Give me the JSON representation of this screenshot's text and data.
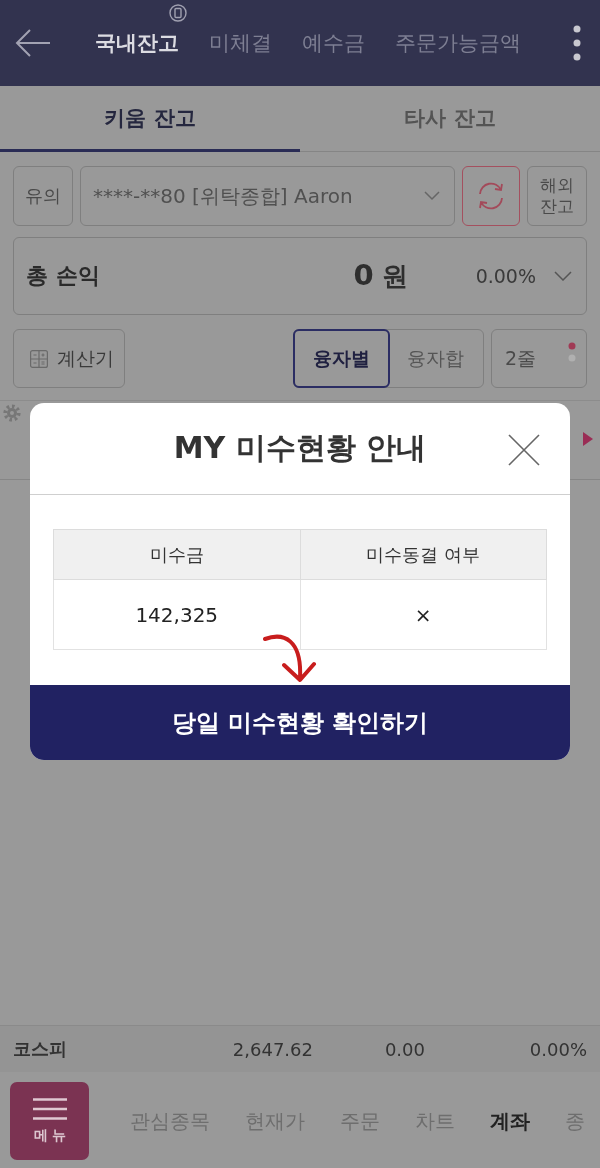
{
  "header": {
    "tabs": [
      {
        "label": "국내잔고",
        "selected": true
      },
      {
        "label": "미체결",
        "selected": false
      },
      {
        "label": "예수금",
        "selected": false
      },
      {
        "label": "주문가능금액",
        "selected": false
      }
    ]
  },
  "sub_tabs": [
    {
      "label": "키움 잔고",
      "selected": true
    },
    {
      "label": "타사 잔고",
      "selected": false
    }
  ],
  "account_bar": {
    "notice_button": "유의",
    "account": "****-**80 [위탁종합] Aaron",
    "overseas_button": "해외잔고"
  },
  "total_profit": {
    "label": "총 손익",
    "amount": "0",
    "unit": "원",
    "rate": "0.00%"
  },
  "tools": {
    "calculator_button": "계산기",
    "loan_view": [
      {
        "label": "융자별",
        "selected": true
      },
      {
        "label": "융자합",
        "selected": false
      }
    ],
    "rows_button": "2줄"
  },
  "dialog": {
    "title": "MY 미수현황 안내",
    "table": {
      "columns": [
        "미수금",
        "미수동결 여부"
      ],
      "rows": [
        [
          "142,325",
          "×"
        ]
      ]
    },
    "confirm_button": "당일 미수현황 확인하기"
  },
  "index_bar": {
    "name": "코스피",
    "value": "2,647.62",
    "change": "0.00",
    "rate": "0.00%"
  },
  "bottom_nav": {
    "menu_button": "메뉴",
    "items": [
      {
        "label": "관심종목",
        "selected": false
      },
      {
        "label": "현재가",
        "selected": false
      },
      {
        "label": "주문",
        "selected": false
      },
      {
        "label": "차트",
        "selected": false
      },
      {
        "label": "계좌",
        "selected": true
      },
      {
        "label": "종",
        "selected": false
      }
    ]
  }
}
